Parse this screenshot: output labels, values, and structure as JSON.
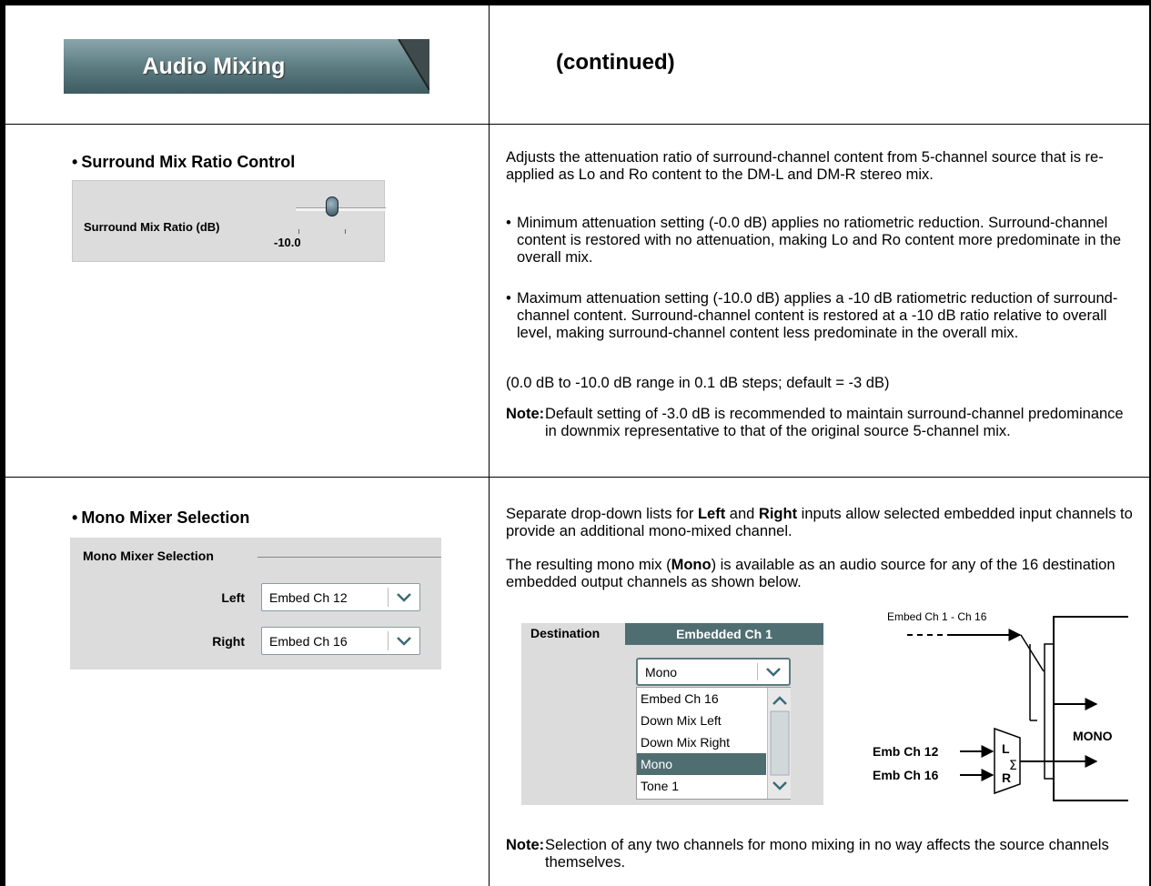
{
  "header": {
    "tab_label": "Audio Mixing",
    "continued": "(continued)"
  },
  "surround": {
    "title": "Surround Mix Ratio Control",
    "panel_label": "Surround Mix Ratio (dB)",
    "panel_value": "-10.0",
    "intro": "Adjusts the attenuation ratio of surround-channel content from 5-channel source that is re-applied as Lo and Ro content to the DM-L and DM-R stereo mix.",
    "bullet1": "Minimum attenuation setting (-0.0 dB) applies no ratiometric reduction. Surround-channel content is restored with no attenuation, making Lo and Ro content more predominate in the overall mix.",
    "bullet2": "Maximum attenuation setting (-10.0 dB) applies a -10 dB ratiometric reduction of surround-channel content. Surround-channel content is restored at a -10 dB ratio relative to overall level, making surround-channel content less predominate in the overall mix.",
    "range": "(0.0 dB to -10.0 dB range in 0.1 dB steps; default = -3 dB)",
    "note_label": "Note:",
    "note": "Default setting of -3.0 dB is recommended to maintain surround-channel predominance in downmix representative to that of the original source 5-channel mix."
  },
  "mono": {
    "title": "Mono Mixer Selection",
    "panel_head": "Mono Mixer Selection",
    "left_label": "Left",
    "left_value": "Embed Ch 12",
    "right_label": "Right",
    "right_value": "Embed Ch 16",
    "para1_a": "Separate drop-down lists for ",
    "para1_b": "Left",
    "para1_c": " and ",
    "para1_d": "Right",
    "para1_e": " inputs allow selected embedded input channels to provide an additional mono-mixed channel.",
    "para2_a": "The resulting mono mix (",
    "para2_b": "Mono",
    "para2_c": ") is available as an audio source for any of the 16 destination embedded output channels as shown below.",
    "dest_label": "Destination",
    "dest_tab": "Embedded Ch 1",
    "dest_value": "Mono",
    "dest_options": [
      "Embed Ch 16",
      "Down Mix Left",
      "Down Mix Right",
      "Mono",
      "Tone 1"
    ],
    "diagram": {
      "embed_range": "Embed Ch 1 - Ch 16",
      "emb12": "Emb Ch 12",
      "emb16": "Emb Ch 16",
      "l": "L",
      "r": "R",
      "sigma": "Σ",
      "mono_out": "MONO"
    },
    "note_label": "Note:",
    "note": "Selection of any two channels for mono mixing in no way affects the source channels themselves."
  }
}
